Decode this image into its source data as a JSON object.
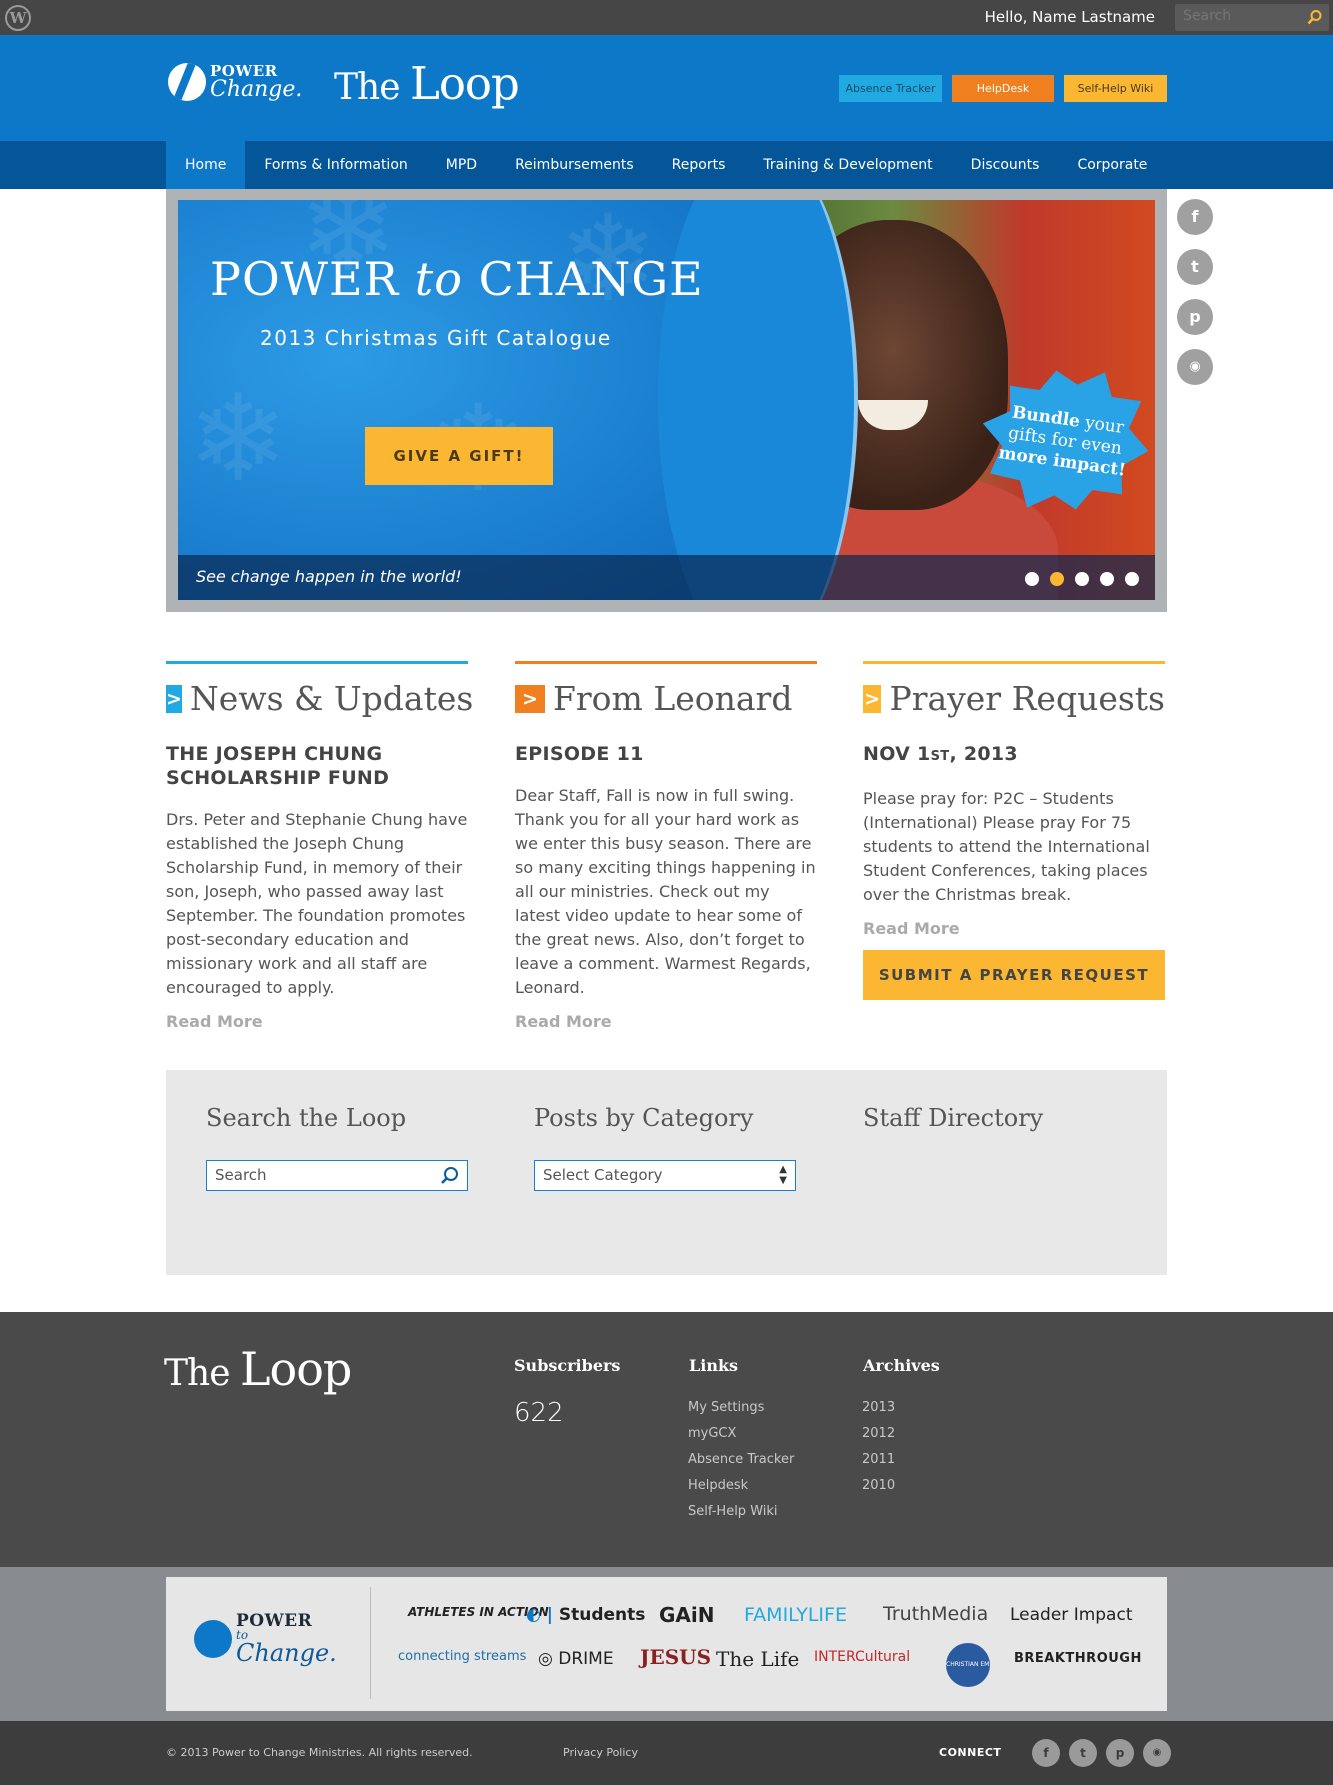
{
  "admin_bar": {
    "greeting": "Hello, Name Lastname",
    "search_placeholder": "Search"
  },
  "header": {
    "logo_top": "POWER",
    "logo_bottom": "Change.",
    "site_title_a": "The ",
    "site_title_b": "Loop",
    "buttons": [
      {
        "label": "Absence Tracker",
        "color": "#21a9e1"
      },
      {
        "label": "HelpDesk",
        "color": "#f07f1f"
      },
      {
        "label": "Self-Help Wiki",
        "color": "#fbb732"
      }
    ]
  },
  "nav": [
    "Home",
    "Forms & Information",
    "MPD",
    "Reimbursements",
    "Reports",
    "Training & Development",
    "Discounts",
    "Corporate"
  ],
  "hero": {
    "title_a": "POWER ",
    "title_em": "to",
    "title_b": " CHANGE",
    "subtitle": "2013 Christmas Gift Catalogue",
    "cta": "GIVE A GIFT!",
    "badge_a": "Bundle",
    "badge_b": " your gifts for even ",
    "badge_c": "more impact!",
    "caption": "See change happen in the world!",
    "active_dot": 1
  },
  "social": [
    "f",
    "t",
    "p",
    "rss"
  ],
  "columns": [
    {
      "title": "News & Updates",
      "color": "#21a9e1",
      "heading": "THE JOSEPH CHUNG SCHOLARSHIP FUND",
      "body": "Drs. Peter and Stephanie Chung have established the Joseph Chung Scholarship Fund, in memory of their son, Joseph, who passed away last September. The foundation promotes post-secondary education and missionary work and all staff are encouraged to apply.",
      "more": "Read More"
    },
    {
      "title": "From Leonard",
      "color": "#f07f1f",
      "heading": "EPISODE 11",
      "body": "Dear Staff, Fall is now in full swing. Thank you for all your hard work as we enter this busy season. There are so many exciting things happening in all our ministries. Check out my latest video update to hear some of the great news. Also, don’t forget to leave a comment. Warmest Regards, Leonard.",
      "more": "Read More"
    },
    {
      "title": "Prayer Requests",
      "color": "#fbb732",
      "heading_a": "NOV 1",
      "heading_sup": "ST",
      "heading_b": ", 2013",
      "body": "Please pray for: P2C – Students (International) Please pray For 75 students to attend the International Student Conferences, taking places over the Christmas break.",
      "more": "Read More",
      "button": "SUBMIT A PRAYER REQUEST"
    }
  ],
  "widgets": {
    "search_title": "Search the Loop",
    "search_placeholder": "Search",
    "category_title": "Posts by Category",
    "category_value": "Select Category",
    "directory_title": "Staff Directory"
  },
  "footer": {
    "logo_a": "The ",
    "logo_b": "Loop",
    "subscribers_title": "Subscribers",
    "subscribers_count": "622",
    "links_title": "Links",
    "links": [
      "My Settings",
      "myGCX",
      "Absence Tracker",
      "Helpdesk",
      "Self-Help Wiki"
    ],
    "archives_title": "Archives",
    "archives": [
      "2013",
      "2012",
      "2011",
      "2010"
    ]
  },
  "partners": [
    "ATHLETES IN ACTION",
    "Students",
    "GAiN",
    "FAMILYLIFE",
    "TruthMedia",
    "Leader Impact",
    "connecting streams",
    "DRIME",
    "JESUS",
    "The Life",
    "INTERCultural",
    "CHRISTIAN EMBASSY",
    "BREAKTHROUGH"
  ],
  "partners_logo": {
    "top": "POWER",
    "mid": "to",
    "bottom": "Change."
  },
  "bottom": {
    "copyright": "© 2013 Power to Change Ministries. All rights reserved.",
    "privacy": "Privacy Policy",
    "connect": "CONNECT",
    "icons": [
      "f",
      "t",
      "p",
      "rss"
    ]
  }
}
